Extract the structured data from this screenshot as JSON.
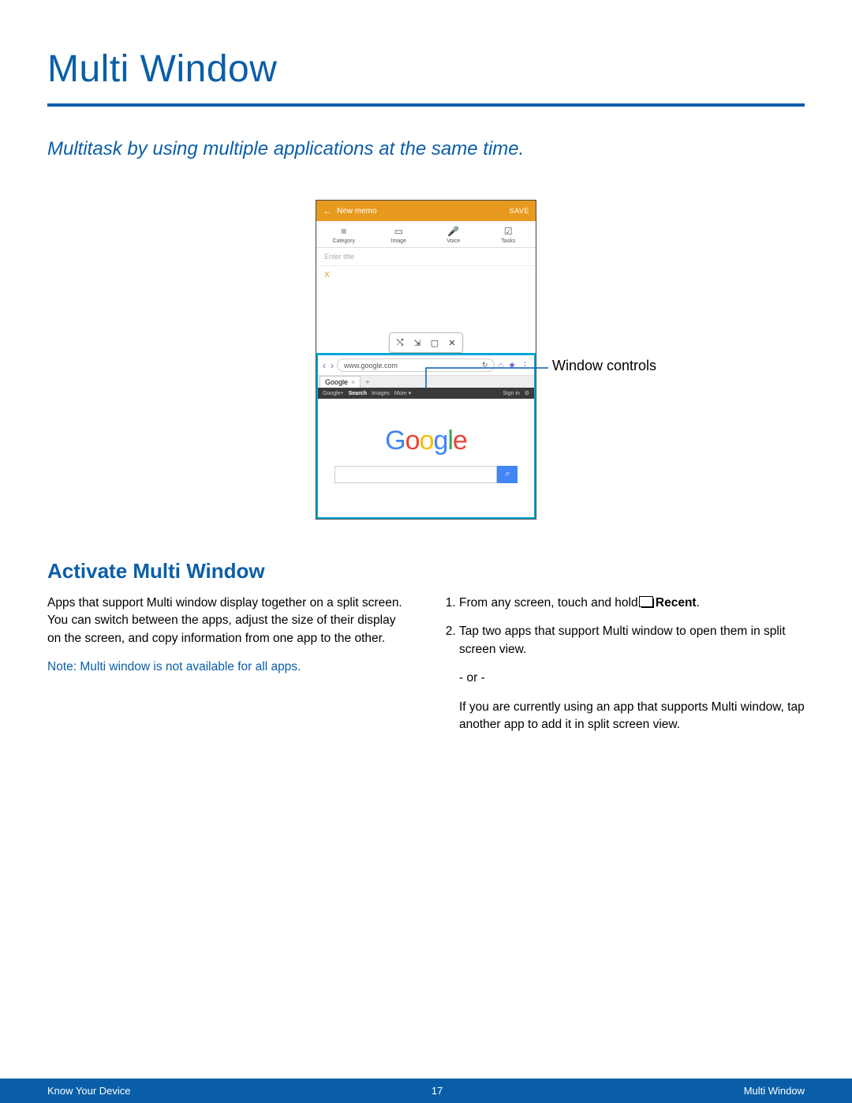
{
  "page": {
    "title": "Multi Window",
    "subtitle": "Multitask by using multiple applications at the same time.",
    "section_title": "Activate Multi Window"
  },
  "figure": {
    "callout": "Window controls",
    "memo": {
      "back": "←",
      "title": "New memo",
      "save": "SAVE",
      "tools": {
        "category": "Category",
        "image": "Image",
        "voice": "Voice",
        "tasks": "Tasks"
      },
      "title_placeholder": "Enter title",
      "body_text": "X"
    },
    "window_controls": {
      "swap": "⤭",
      "drag": "⇲",
      "maximize": "▢",
      "close": "✕"
    },
    "browser": {
      "nav_back": "‹",
      "nav_fwd": "›",
      "url": "www.google.com",
      "refresh": "↻",
      "home": "⌂",
      "bookmark": "★",
      "more": "⋮",
      "tab_label": "Google",
      "tab_add": "+",
      "bar_left": [
        "Google+",
        "Search",
        "Images",
        "More ▾"
      ],
      "bar_right_signin": "Sign in",
      "bar_right_gear": "⚙",
      "logo": {
        "g1": "G",
        "o1": "o",
        "o2": "o",
        "g2": "g",
        "l": "l",
        "e": "e"
      },
      "search_icon": "⌕"
    }
  },
  "body": {
    "intro": "Apps that support Multi window display together on a split screen. You can switch between the apps, adjust the size of their display on the screen, and copy information from one app to the other.",
    "note_label": "Note",
    "note_text": ": Multi window is not available for all apps.",
    "steps": {
      "s1_pre": "From any screen, touch and hold ",
      "s1_bold": "Recent",
      "s1_post": ".",
      "s2": "Tap two apps that support Multi window to open them in split screen view.",
      "or": "- or -",
      "s2b": "If you are currently using an app that supports Multi window, tap another app to add it in split screen view."
    }
  },
  "footer": {
    "left": "Know Your Device",
    "center": "17",
    "right": "Multi Window"
  }
}
